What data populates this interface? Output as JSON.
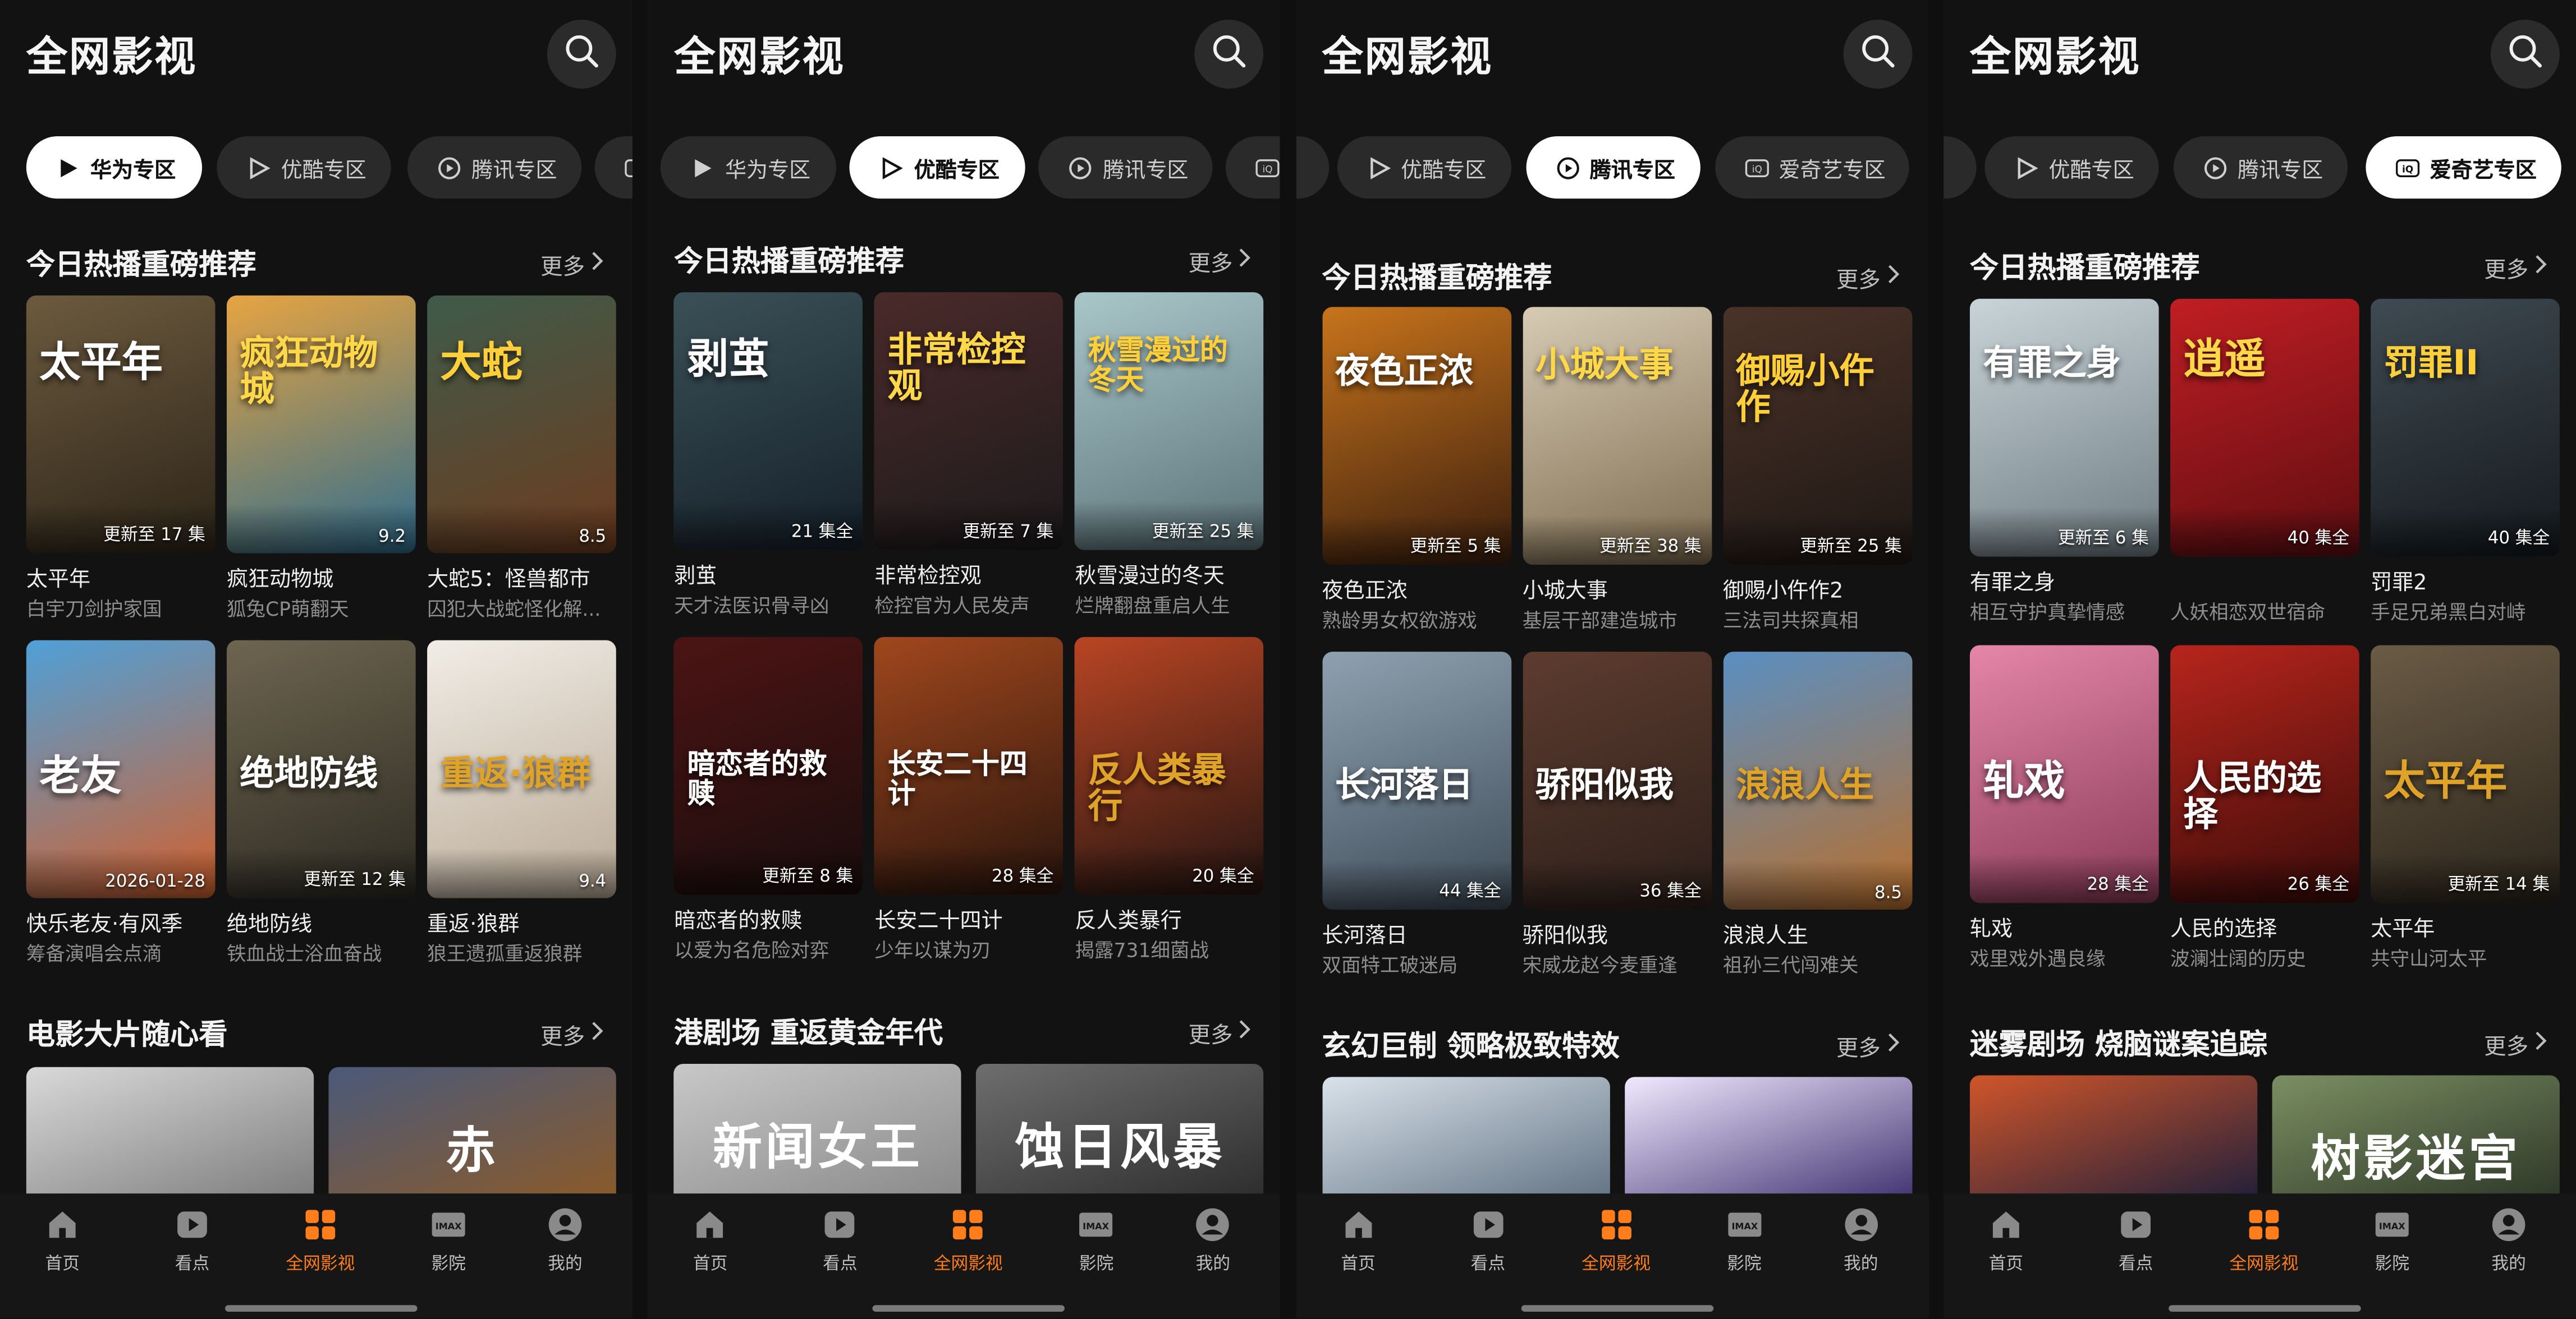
{
  "colors": {
    "background": "#121212",
    "accent": "#ff7d1a",
    "chip": "#2a2a2a",
    "chip_active": "#ffffff"
  },
  "screens": [
    {
      "app_title": "全网影视",
      "search_icon": "search-icon",
      "tabs": [
        {
          "label": "华为专区",
          "icon": "huawei-play-icon",
          "active": true
        },
        {
          "label": "优酷专区",
          "icon": "youku-icon",
          "active": false
        },
        {
          "label": "腾讯专区",
          "icon": "tencent-video-icon",
          "active": false
        },
        {
          "label": "",
          "icon": "iqiyi-icon",
          "active": false
        }
      ],
      "section1": {
        "title": "今日热播重磅推荐",
        "more": "更多"
      },
      "cards": [
        {
          "name": "太平年",
          "desc": "白宇刀剑护家国",
          "badge": "更新至 17 集",
          "poster_text": "太平年"
        },
        {
          "name": "疯狂动物城",
          "desc": "狐兔CP萌翻天",
          "badge": "9.2",
          "poster_text": "疯狂动物城"
        },
        {
          "name": "大蛇5：怪兽都市",
          "desc": "囚犯大战蛇怪化解...",
          "badge": "8.5",
          "poster_text": "大蛇"
        },
        {
          "name": "快乐老友·有风季",
          "desc": "筹备演唱会点滴",
          "badge": "2026-01-28",
          "poster_text": "老友"
        },
        {
          "name": "绝地防线",
          "desc": "铁血战士浴血奋战",
          "badge": "更新至 12 集",
          "poster_text": "绝地防线"
        },
        {
          "name": "重返·狼群",
          "desc": "狼王遗孤重返狼群",
          "badge": "9.4",
          "poster_text": "重返·狼群"
        }
      ],
      "section2": {
        "title": "电影大片随心看",
        "more": "更多"
      },
      "banners": [
        {
          "text": ""
        },
        {
          "text": "赤"
        }
      ]
    },
    {
      "app_title": "全网影视",
      "search_icon": "search-icon",
      "tabs": [
        {
          "label": "华为专区",
          "icon": "huawei-play-icon",
          "active": false
        },
        {
          "label": "优酷专区",
          "icon": "youku-icon",
          "active": true
        },
        {
          "label": "腾讯专区",
          "icon": "tencent-video-icon",
          "active": false
        },
        {
          "label": "",
          "icon": "iqiyi-icon",
          "active": false
        }
      ],
      "section1": {
        "title": "今日热播重磅推荐",
        "more": "更多"
      },
      "cards": [
        {
          "name": "剥茧",
          "desc": "天才法医识骨寻凶",
          "badge": "21 集全",
          "poster_text": "剥茧"
        },
        {
          "name": "非常检控观",
          "desc": "检控官为人民发声",
          "badge": "更新至 7 集",
          "poster_text": "非常检控观"
        },
        {
          "name": "秋雪漫过的冬天",
          "desc": "烂牌翻盘重启人生",
          "badge": "更新至 25 集",
          "poster_text": "秋雪漫过的冬天"
        },
        {
          "name": "暗恋者的救赎",
          "desc": "以爱为名危险对弈",
          "badge": "更新至 8 集",
          "poster_text": "暗恋者的救赎"
        },
        {
          "name": "长安二十四计",
          "desc": "少年以谋为刃",
          "badge": "28 集全",
          "poster_text": "长安二十四计"
        },
        {
          "name": "反人类暴行",
          "desc": "揭露731细菌战",
          "badge": "20 集全",
          "poster_text": "反人类暴行"
        }
      ],
      "section2": {
        "title": "港剧场 重返黄金年代",
        "more": "更多"
      },
      "banners": [
        {
          "text": "新闻女王"
        },
        {
          "text": "蚀日风暴"
        }
      ]
    },
    {
      "app_title": "全网影视",
      "search_icon": "search-icon",
      "tabs": [
        {
          "label": "",
          "icon": "huawei-play-icon",
          "active": false
        },
        {
          "label": "优酷专区",
          "icon": "youku-icon",
          "active": false
        },
        {
          "label": "腾讯专区",
          "icon": "tencent-video-icon",
          "active": true
        },
        {
          "label": "爱奇艺专区",
          "icon": "iqiyi-icon",
          "active": false
        }
      ],
      "section1": {
        "title": "今日热播重磅推荐",
        "more": "更多"
      },
      "cards": [
        {
          "name": "夜色正浓",
          "desc": "熟龄男女权欲游戏",
          "badge": "更新至 5 集",
          "poster_text": "夜色正浓"
        },
        {
          "name": "小城大事",
          "desc": "基层干部建造城市",
          "badge": "更新至 38 集",
          "poster_text": "小城大事"
        },
        {
          "name": "御赐小仵作2",
          "desc": "三法司共探真相",
          "badge": "更新至 25 集",
          "poster_text": "御赐小仵作"
        },
        {
          "name": "长河落日",
          "desc": "双面特工破迷局",
          "badge": "44 集全",
          "poster_text": "长河落日"
        },
        {
          "name": "骄阳似我",
          "desc": "宋威龙赵今麦重逢",
          "badge": "36 集全",
          "poster_text": "骄阳似我"
        },
        {
          "name": "浪浪人生",
          "desc": "祖孙三代闯难关",
          "badge": "8.5",
          "poster_text": "浪浪人生"
        }
      ],
      "section2": {
        "title": "玄幻巨制 领略极致特效",
        "more": "更多"
      },
      "banners": [
        {
          "text": ""
        },
        {
          "text": ""
        }
      ]
    },
    {
      "app_title": "全网影视",
      "search_icon": "search-icon",
      "tabs": [
        {
          "label": "",
          "icon": "huawei-play-icon",
          "active": false
        },
        {
          "label": "优酷专区",
          "icon": "youku-icon",
          "active": false
        },
        {
          "label": "腾讯专区",
          "icon": "tencent-video-icon",
          "active": false
        },
        {
          "label": "爱奇艺专区",
          "icon": "iqiyi-icon",
          "active": true
        }
      ],
      "section1": {
        "title": "今日热播重磅推荐",
        "more": "更多"
      },
      "cards": [
        {
          "name": "有罪之身",
          "desc": "相互守护真挚情感",
          "badge": "更新至 6 集",
          "poster_text": "有罪之身"
        },
        {
          "name": "",
          "desc": "人妖相恋双世宿命",
          "badge": "40 集全",
          "poster_text": "逍遥"
        },
        {
          "name": "罚罪2",
          "desc": "手足兄弟黑白对峙",
          "badge": "40 集全",
          "poster_text": "罚罪II"
        },
        {
          "name": "轧戏",
          "desc": "戏里戏外遇良缘",
          "badge": "28 集全",
          "poster_text": "轧戏"
        },
        {
          "name": "人民的选择",
          "desc": "波澜壮阔的历史",
          "badge": "26 集全",
          "poster_text": "人民的选择"
        },
        {
          "name": "太平年",
          "desc": "共守山河太平",
          "badge": "更新至 14 集",
          "poster_text": "太平年"
        }
      ],
      "section2": {
        "title": "迷雾剧场 烧脑谜案追踪",
        "more": "更多"
      },
      "banners": [
        {
          "text": ""
        },
        {
          "text": "树影迷宫"
        }
      ]
    }
  ],
  "nav": [
    {
      "label": "首页",
      "icon": "home-icon",
      "active": false
    },
    {
      "label": "看点",
      "icon": "play-icon",
      "active": false
    },
    {
      "label": "全网影视",
      "icon": "grid-icon",
      "active": true
    },
    {
      "label": "影院",
      "icon": "imax-icon",
      "active": false
    },
    {
      "label": "我的",
      "icon": "profile-icon",
      "active": false
    }
  ]
}
